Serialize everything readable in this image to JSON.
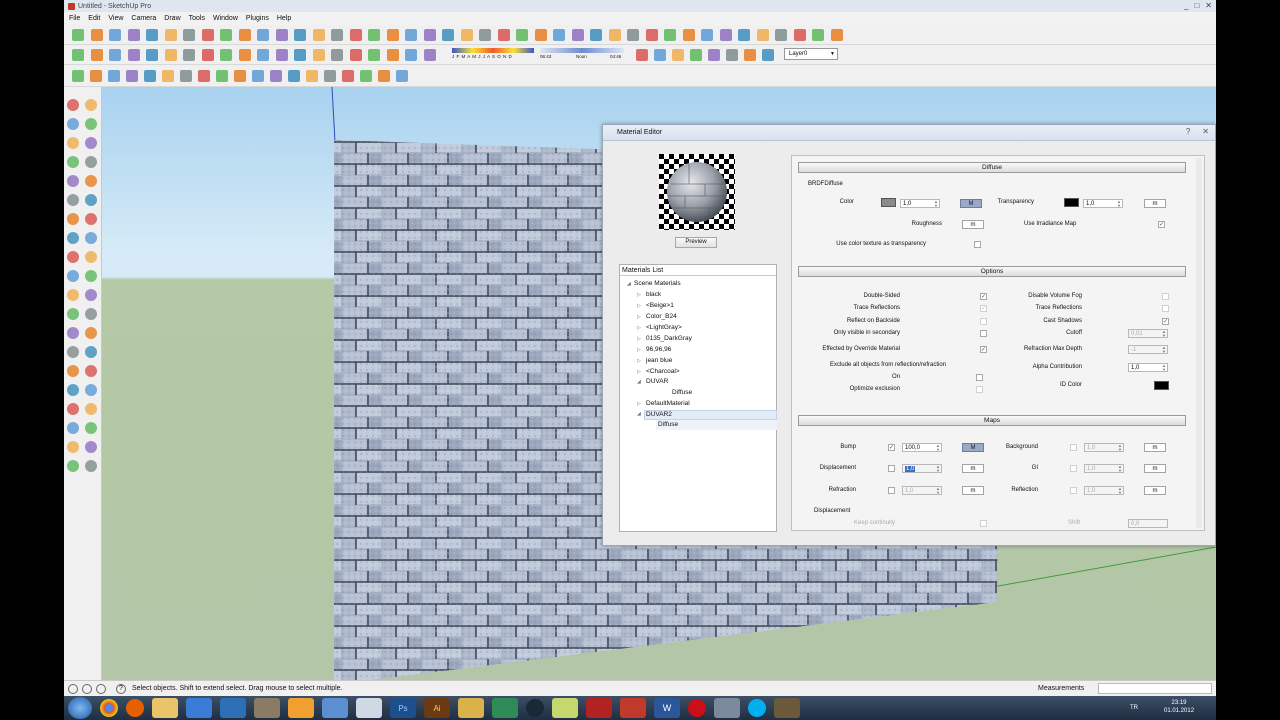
{
  "app": {
    "title": "Untitled - SketchUp Pro",
    "window_buttons": [
      "_",
      "□",
      "✕"
    ]
  },
  "menu": [
    "File",
    "Edit",
    "View",
    "Camera",
    "Draw",
    "Tools",
    "Window",
    "Plugins",
    "Help"
  ],
  "shadow": {
    "months": "J F M A M J J A S O N D",
    "time_start": "06:43",
    "time_mid": "Noon",
    "time_end": "04:46"
  },
  "layer": {
    "value": "Layer0"
  },
  "status": {
    "text": "Select objects. Shift to extend select. Drag mouse to select multiple.",
    "measurements_label": "Measurements"
  },
  "tray": {
    "lang": "TR",
    "time": "23:19",
    "date": "01.01.2012"
  },
  "editor": {
    "title": "Material Editor",
    "preview_button": "Preview",
    "materials_list_title": "Materials List",
    "tree": [
      {
        "label": "Scene Materials",
        "expanded": true
      },
      {
        "label": "black"
      },
      {
        "label": "<Beige>1"
      },
      {
        "label": "Color_B24"
      },
      {
        "label": "<LightGray>"
      },
      {
        "label": "0135_DarkGray"
      },
      {
        "label": "96,96,96"
      },
      {
        "label": "jean blue"
      },
      {
        "label": "<Charcoal>"
      },
      {
        "label": "DUVAR",
        "expanded": true
      },
      {
        "label": "Diffuse"
      },
      {
        "label": "DefaultMaterial"
      },
      {
        "label": "DUVAR2",
        "expanded": true,
        "selected": true
      },
      {
        "label": "Diffuse",
        "selected": true
      }
    ],
    "diffuse": {
      "section": "Diffuse",
      "brdf": "BRDFDiffuse",
      "color_label": "Color",
      "color_value": "1,0",
      "color_swatch": "#8a8a8a",
      "transparency_label": "Transparency",
      "transparency_value": "1,0",
      "transparency_swatch": "#000000",
      "roughness_label": "Roughness",
      "irradiance_label": "Use Irradiance Map",
      "tex_transparency_label": "Use color texture as transparency"
    },
    "options": {
      "section": "Options",
      "left": [
        "Double-Sided",
        "Trace Reflections",
        "Reflect on Backside",
        "Only visible in secondary",
        "Effected by Override Material",
        "Exclude all objects from reflection/refraction",
        "On",
        "Optimize exclusion"
      ],
      "right": [
        "Disable Volume Fog",
        "Trace Reflections",
        "Cast Shadows",
        "Cutoff",
        "Refraction Max Depth",
        "Alpha Contribution",
        "ID Color"
      ],
      "cutoff": "0,01",
      "refraction_depth": "-1",
      "alpha": "1,0",
      "id_color": "#000000"
    },
    "maps": {
      "section": "Maps",
      "bump_label": "Bump",
      "bump_value": "100,0",
      "displacement_label": "Displacement",
      "displacement_value": "1,0",
      "refraction_label": "Refraction",
      "refraction_value": "1,0",
      "background_label": "Background",
      "background_value": "1,0",
      "gi_label": "GI",
      "gi_value": "1,0",
      "reflection_label": "Reflection",
      "reflection_value": "1,0",
      "disp_header": "Displacement",
      "keep_label": "Keep continuity",
      "shift_label": "Shift",
      "shift_value": "0,0"
    },
    "m_label": "M",
    "small_m": "m"
  }
}
